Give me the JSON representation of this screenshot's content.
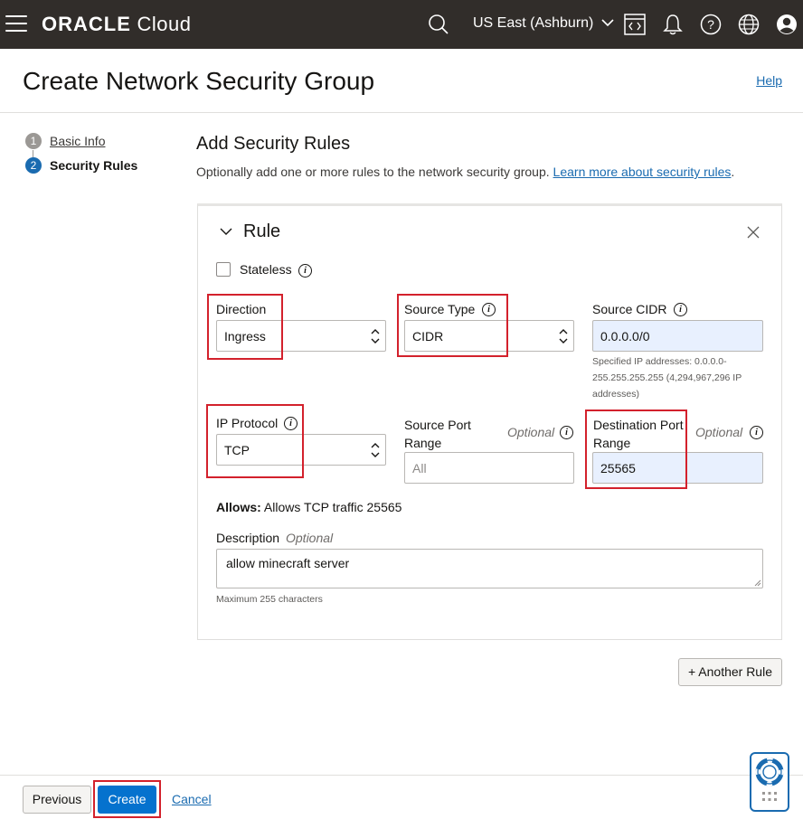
{
  "topbar": {
    "brand_bold": "ORACLE",
    "brand_light": "Cloud",
    "region": "US East (Ashburn)"
  },
  "header": {
    "title": "Create Network Security Group",
    "help": "Help"
  },
  "steps": [
    {
      "num": "1",
      "label": "Basic Info"
    },
    {
      "num": "2",
      "label": "Security Rules"
    }
  ],
  "section": {
    "title": "Add Security Rules",
    "desc": "Optionally add one or more rules to the network security group.",
    "learn_more": "Learn more about security rules",
    "desc_end": "."
  },
  "rule": {
    "title": "Rule",
    "stateless_label": "Stateless",
    "direction_label": "Direction",
    "direction_value": "Ingress",
    "source_type_label": "Source Type",
    "source_type_value": "CIDR",
    "source_cidr_label": "Source CIDR",
    "source_cidr_value": "0.0.0.0/0",
    "source_cidr_help_1": "Specified IP addresses: 0.0.0.0-",
    "source_cidr_help_2": "255.255.255.255 (4,294,967,296 IP",
    "source_cidr_help_3": "addresses)",
    "ip_protocol_label": "IP Protocol",
    "ip_protocol_value": "TCP",
    "source_port_label_1": "Source Port",
    "source_port_label_2": "Range",
    "source_port_optional": "Optional",
    "source_port_placeholder": "All",
    "dest_port_label_1": "Destination Port",
    "dest_port_label_2": "Range",
    "dest_port_optional": "Optional",
    "dest_port_value": "25565",
    "allows_label": "Allows:",
    "allows_text": "Allows TCP traffic 25565",
    "description_label": "Description",
    "description_optional": "Optional",
    "description_value": "allow minecraft server",
    "description_help": "Maximum 255 characters"
  },
  "buttons": {
    "another_rule": "+ Another Rule",
    "previous": "Previous",
    "create": "Create",
    "cancel": "Cancel"
  },
  "icons": {
    "info_glyph": "i"
  },
  "colors": {
    "topbar": "#312d2a",
    "primary": "#0572ce",
    "link": "#1a6bb0",
    "highlight": "#d3212c",
    "autofill": "#e8f0fe"
  }
}
